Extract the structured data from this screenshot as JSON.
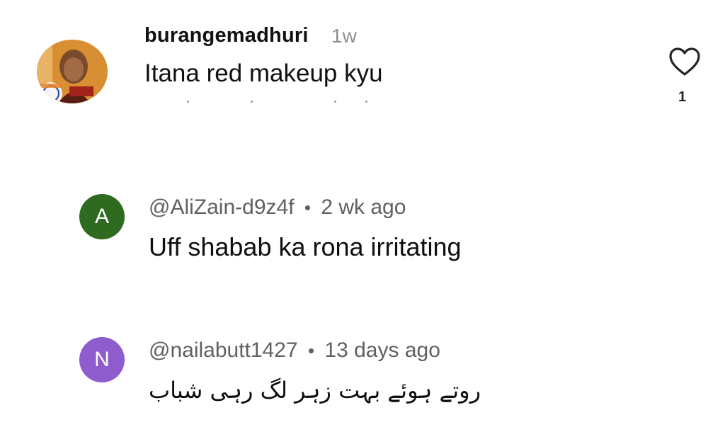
{
  "instagram_comment": {
    "username": "burangemadhuri",
    "time": "1w",
    "text": "Itana red makeup kyu",
    "like_count": "1",
    "icons": {
      "like": "heart-outline-icon"
    }
  },
  "youtube_comments": [
    {
      "avatar_letter": "A",
      "avatar_color": "#2e6b20",
      "handle": "@AliZain-d9z4f",
      "separator": "•",
      "time": "2 wk ago",
      "text": "Uff shabab ka rona  irritating"
    },
    {
      "avatar_letter": "N",
      "avatar_color": "#8e5ccc",
      "handle": "@nailabutt1427",
      "separator": "•",
      "time": "13 days ago",
      "text": "روتے ہوئے بہت زہر لگ رہی شباب"
    }
  ]
}
